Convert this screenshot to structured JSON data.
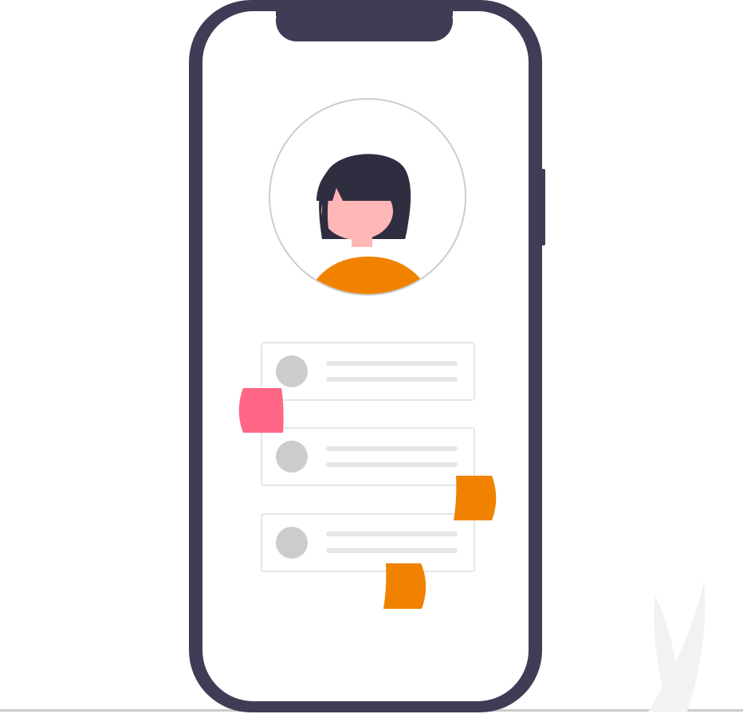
{
  "colors": {
    "phone_frame": "#3f3d56",
    "screen": "#ffffff",
    "accent_orange": "#f08200",
    "accent_pink": "#ff6584",
    "hair": "#2f2e41",
    "skin": "#ffb6b6",
    "placeholder_gray": "#cccccc",
    "line_gray": "#e6e6e6",
    "card_border": "#e6e6e6",
    "avatar_ring": "#cccccc",
    "ground": "#cccccc",
    "plant": "#f2f2f2"
  },
  "list": {
    "items": [
      {
        "id": "item-1",
        "status": "pink"
      },
      {
        "id": "item-2",
        "status": "orange"
      },
      {
        "id": "item-3",
        "status": "orange"
      }
    ]
  }
}
